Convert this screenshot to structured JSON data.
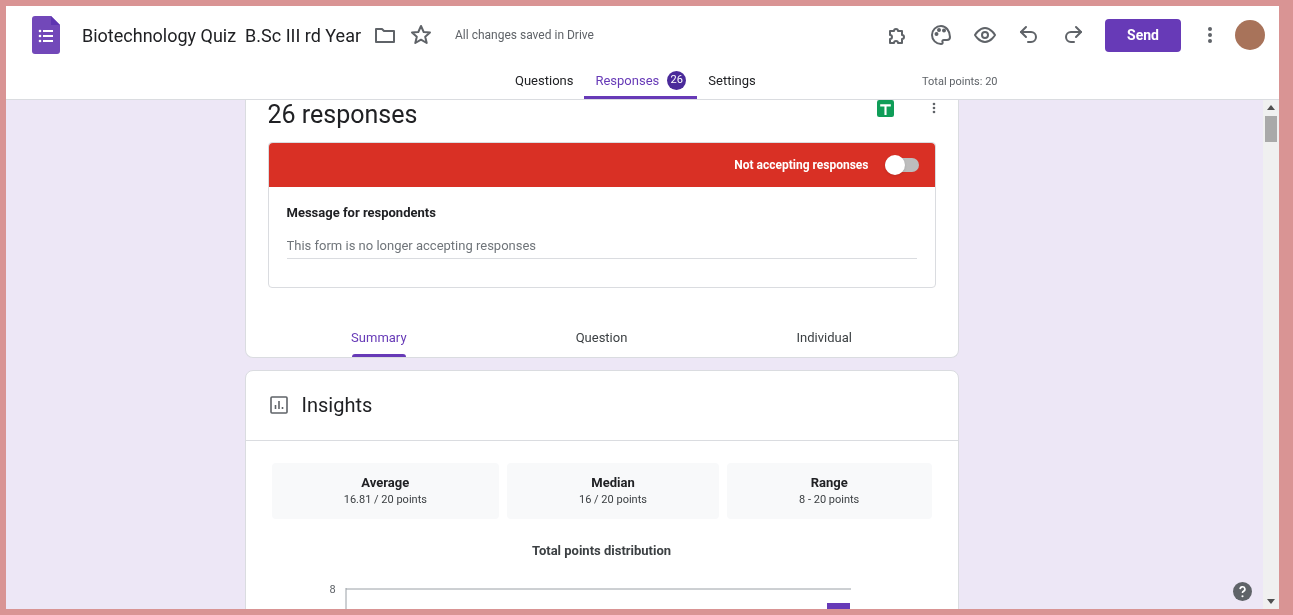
{
  "header": {
    "title": "Biotechnology Quiz  B.Sc III rd Year",
    "save_status": "All changes saved in Drive",
    "send_button": "Send"
  },
  "tabs": [
    {
      "label": "Questions",
      "selected": false
    },
    {
      "label": "Responses",
      "selected": true,
      "badge": "26"
    },
    {
      "label": "Settings",
      "selected": false
    }
  ],
  "total_points": "Total points: 20",
  "responses_card": {
    "heading": "26 responses",
    "accepting_label": "Not accepting responses",
    "accepting": false,
    "message_label": "Message for respondents",
    "message": "This form is no longer accepting responses",
    "view_tabs": [
      {
        "label": "Summary",
        "selected": true
      },
      {
        "label": "Question",
        "selected": false
      },
      {
        "label": "Individual",
        "selected": false
      }
    ]
  },
  "insights": {
    "title": "Insights",
    "stats": [
      {
        "label": "Average",
        "value": "16.81 / 20 points"
      },
      {
        "label": "Median",
        "value": "16 / 20 points"
      },
      {
        "label": "Range",
        "value": "8 - 20 points"
      }
    ],
    "chart_title": "Total points distribution",
    "chart_tick": "8"
  }
}
